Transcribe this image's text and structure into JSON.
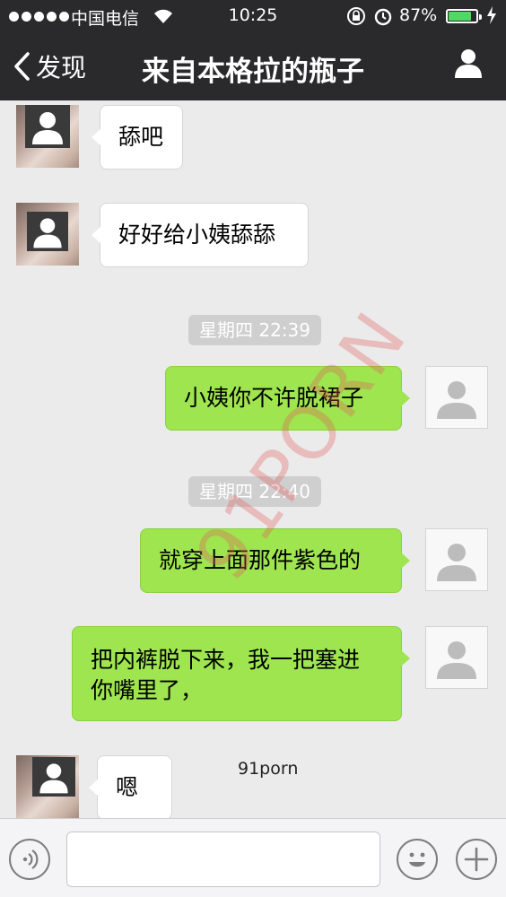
{
  "status_bar": {
    "carrier": "中国电信",
    "time": "10:25",
    "battery_percent": "87%",
    "battery_level": 0.87
  },
  "nav": {
    "back_label": "发现",
    "title": "来自本格拉的瓶子"
  },
  "messages": [
    {
      "side": "left",
      "text": "舔吧"
    },
    {
      "side": "left",
      "text": "好好给小姨舔舔"
    },
    {
      "type": "time",
      "text": "星期四 22:39"
    },
    {
      "side": "right",
      "text": "小姨你不许脱裙子"
    },
    {
      "type": "time",
      "text": "星期四 22:40"
    },
    {
      "side": "right",
      "text": "就穿上面那件紫色的"
    },
    {
      "side": "right",
      "text": "把内裤脱下来，我一把塞进你嘴里了，"
    },
    {
      "side": "left",
      "text": "嗯"
    }
  ],
  "watermark": {
    "large": "91PORN",
    "small": "91porn"
  },
  "colors": {
    "nav_bg": "#2a2a2c",
    "chat_bg": "#ebebeb",
    "outgoing_bubble": "#9ee54f",
    "incoming_bubble": "#ffffff",
    "battery_fill": "#4cd964"
  }
}
